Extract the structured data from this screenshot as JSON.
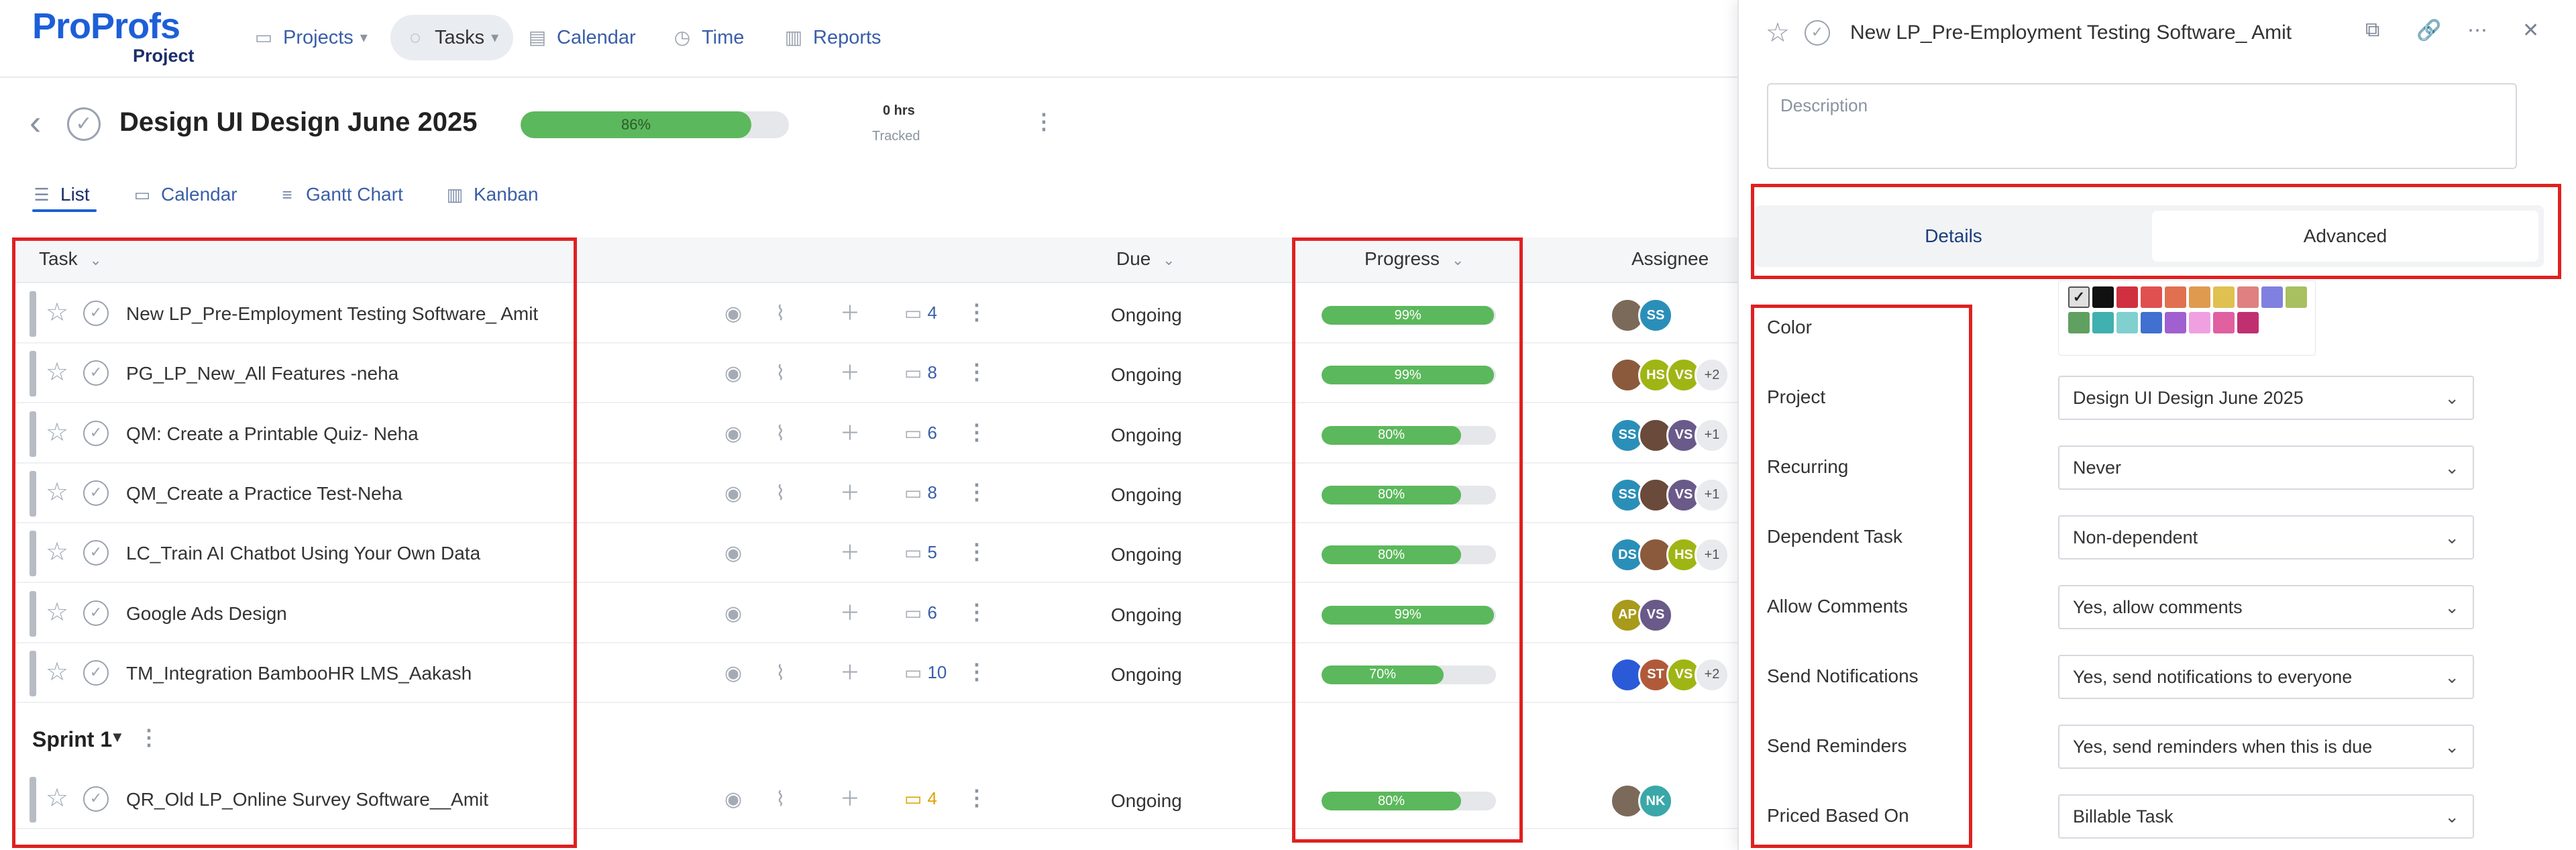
{
  "nav": {
    "logo_pro": "Pro",
    "logo_profs": "Profs",
    "logo_sub": "Project",
    "items": [
      {
        "label": "Projects",
        "icon": "briefcase-icon",
        "caret": "▾"
      },
      {
        "label": "Tasks",
        "icon": "check-circle-icon",
        "caret": "▾"
      },
      {
        "label": "Calendar",
        "icon": "calendar-icon"
      },
      {
        "label": "Time",
        "icon": "clock-icon"
      },
      {
        "label": "Reports",
        "icon": "bar-chart-icon"
      }
    ]
  },
  "project": {
    "title": "Design UI Design June 2025",
    "progress_label": "86%",
    "progress": 86,
    "tracked_hours": "0 hrs",
    "tracked_label": "Tracked"
  },
  "view_tabs": [
    {
      "label": "List",
      "icon": "list-icon"
    },
    {
      "label": "Calendar",
      "icon": "calendar-icon"
    },
    {
      "label": "Gantt Chart",
      "icon": "gantt-icon"
    },
    {
      "label": "Kanban",
      "icon": "kanban-icon"
    }
  ],
  "table": {
    "headers": {
      "task": "Task",
      "due": "Due",
      "progress": "Progress",
      "assignee": "Assignee"
    },
    "rows": [
      {
        "name": "New LP_Pre-Employment Testing Software_ Amit",
        "comments": "4",
        "due": "Ongoing",
        "progress_label": "99%",
        "progress": 99,
        "assignees": [
          {
            "initials": "",
            "color": "#7b6a5a"
          },
          {
            "initials": "SS",
            "color": "#2a8fb8"
          }
        ],
        "more": ""
      },
      {
        "name": "PG_LP_New_All Features -neha",
        "comments": "8",
        "due": "Ongoing",
        "progress_label": "99%",
        "progress": 99,
        "assignees": [
          {
            "initials": "",
            "color": "#8b5a3c"
          },
          {
            "initials": "HS",
            "color": "#9fb514"
          },
          {
            "initials": "VS",
            "color": "#9fb514"
          }
        ],
        "more": "+2"
      },
      {
        "name": "QM: Create a Printable Quiz- Neha",
        "comments": "6",
        "due": "Ongoing",
        "progress_label": "80%",
        "progress": 80,
        "assignees": [
          {
            "initials": "SS",
            "color": "#2a8fb8"
          },
          {
            "initials": "",
            "color": "#6a4a3a"
          },
          {
            "initials": "VS",
            "color": "#6a5a8a"
          }
        ],
        "more": "+1"
      },
      {
        "name": "QM_Create a Practice Test-Neha",
        "comments": "8",
        "due": "Ongoing",
        "progress_label": "80%",
        "progress": 80,
        "assignees": [
          {
            "initials": "SS",
            "color": "#2a8fb8"
          },
          {
            "initials": "",
            "color": "#6a4a3a"
          },
          {
            "initials": "VS",
            "color": "#6a5a8a"
          }
        ],
        "more": "+1"
      },
      {
        "name": "LC_Train AI Chatbot Using Your Own Data",
        "comments": "5",
        "due": "Ongoing",
        "progress_label": "80%",
        "progress": 80,
        "assignees": [
          {
            "initials": "DS",
            "color": "#2a8fb8"
          },
          {
            "initials": "",
            "color": "#8b5a3c"
          },
          {
            "initials": "HS",
            "color": "#9fb514"
          }
        ],
        "more": "+1"
      },
      {
        "name": "Google Ads Design",
        "comments": "6",
        "due": "Ongoing",
        "progress_label": "99%",
        "progress": 99,
        "assignees": [
          {
            "initials": "AP",
            "color": "#a89a1a"
          },
          {
            "initials": "VS",
            "color": "#6a5a8a"
          }
        ],
        "more": ""
      },
      {
        "name": "TM_Integration BambooHR LMS_Aakash",
        "comments": "10",
        "due": "Ongoing",
        "progress_label": "70%",
        "progress": 70,
        "assignees": [
          {
            "initials": "",
            "color": "#2a5ad8"
          },
          {
            "initials": "ST",
            "color": "#b05a3a"
          },
          {
            "initials": "VS",
            "color": "#9fb514"
          }
        ],
        "more": "+2"
      }
    ],
    "sprint": {
      "label": "Sprint 1",
      "caret": "▼"
    },
    "sprint_rows": [
      {
        "name": "QR_Old LP_Online Survey Software__Amit",
        "comments": "4",
        "due": "Ongoing",
        "progress_label": "80%",
        "progress": 80,
        "assignees": [
          {
            "initials": "",
            "color": "#7b6a5a"
          },
          {
            "initials": "NK",
            "color": "#3aa8a8"
          }
        ],
        "more": ""
      }
    ]
  },
  "panel": {
    "title": "New LP_Pre-Employment Testing Software_ Amit",
    "description_placeholder": "Description",
    "tabs": {
      "details": "Details",
      "advanced": "Advanced"
    },
    "swatch_colors": [
      "#e0e0e0",
      "#111111",
      "#d03040",
      "#e05050",
      "#e07050",
      "#e09a50",
      "#e0c050",
      "#e08080",
      "#8080e0",
      "#a8c060",
      "#60a060",
      "#40b0b0",
      "#80d0d0",
      "#4070d0",
      "#a060d0",
      "#f0a0e0",
      "#e060a0",
      "#c03070"
    ],
    "fields": [
      {
        "label": "Color"
      },
      {
        "label": "Project",
        "value": "Design UI Design June 2025"
      },
      {
        "label": "Recurring",
        "value": "Never"
      },
      {
        "label": "Dependent Task",
        "value": "Non-dependent"
      },
      {
        "label": "Allow Comments",
        "value": "Yes, allow comments"
      },
      {
        "label": "Send Notifications",
        "value": "Yes, send notifications to everyone"
      },
      {
        "label": "Send Reminders",
        "value": "Yes, send reminders when this is due"
      },
      {
        "label": "Priced Based On",
        "value": "Billable Task"
      }
    ]
  },
  "colors": {
    "accent": "#1d5fd8",
    "progress": "#5cb85c",
    "annotation": "#e02020"
  }
}
